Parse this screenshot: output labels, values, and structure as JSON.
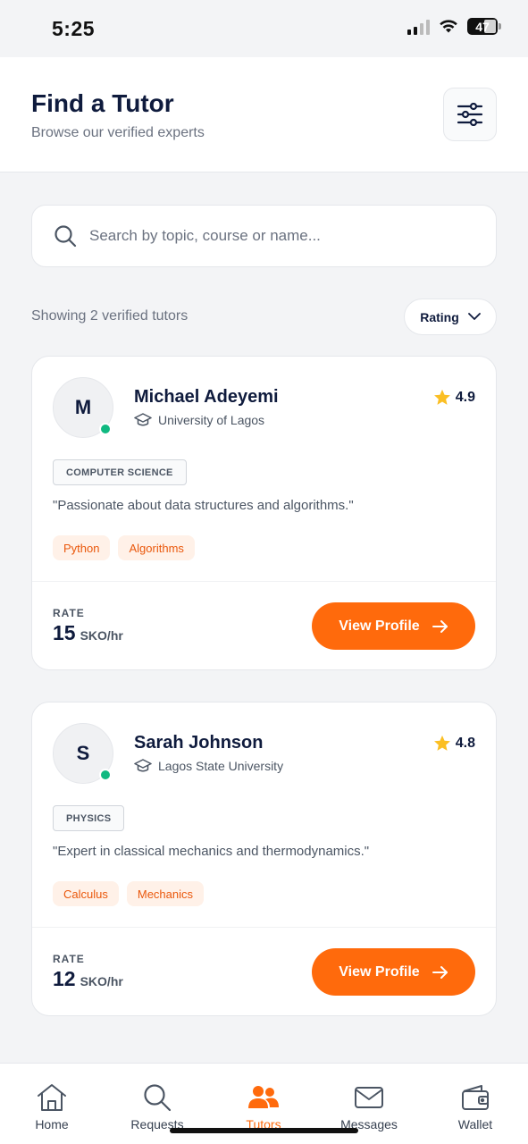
{
  "status_bar": {
    "time": "5:25",
    "battery": "47"
  },
  "header": {
    "title": "Find a Tutor",
    "subtitle": "Browse our verified experts"
  },
  "search": {
    "placeholder": "Search by topic, course or name..."
  },
  "results": {
    "showing_text": "Showing 2 verified tutors",
    "sort_label": "Rating"
  },
  "tutors": [
    {
      "initial": "M",
      "name": "Michael Adeyemi",
      "university": "University of Lagos",
      "rating": "4.9",
      "subject": "COMPUTER SCIENCE",
      "quote": "\"Passionate about data structures and algorithms.\"",
      "skills": [
        "Python",
        "Algorithms"
      ],
      "rate_label": "RATE",
      "rate": "15",
      "rate_unit": "SKO/hr",
      "button_label": "View Profile"
    },
    {
      "initial": "S",
      "name": "Sarah Johnson",
      "university": "Lagos State University",
      "rating": "4.8",
      "subject": "PHYSICS",
      "quote": "\"Expert in classical mechanics and thermodynamics.\"",
      "skills": [
        "Calculus",
        "Mechanics"
      ],
      "rate_label": "RATE",
      "rate": "12",
      "rate_unit": "SKO/hr",
      "button_label": "View Profile"
    }
  ],
  "nav": [
    {
      "label": "Home",
      "icon": "home-icon"
    },
    {
      "label": "Requests",
      "icon": "search-icon"
    },
    {
      "label": "Tutors",
      "icon": "users-icon",
      "active": true
    },
    {
      "label": "Messages",
      "icon": "mail-icon"
    },
    {
      "label": "Wallet",
      "icon": "wallet-icon"
    }
  ],
  "colors": {
    "accent": "#ff6a0c",
    "online": "#10b981",
    "star": "#fbbf24",
    "navy": "#0f1b3d"
  }
}
